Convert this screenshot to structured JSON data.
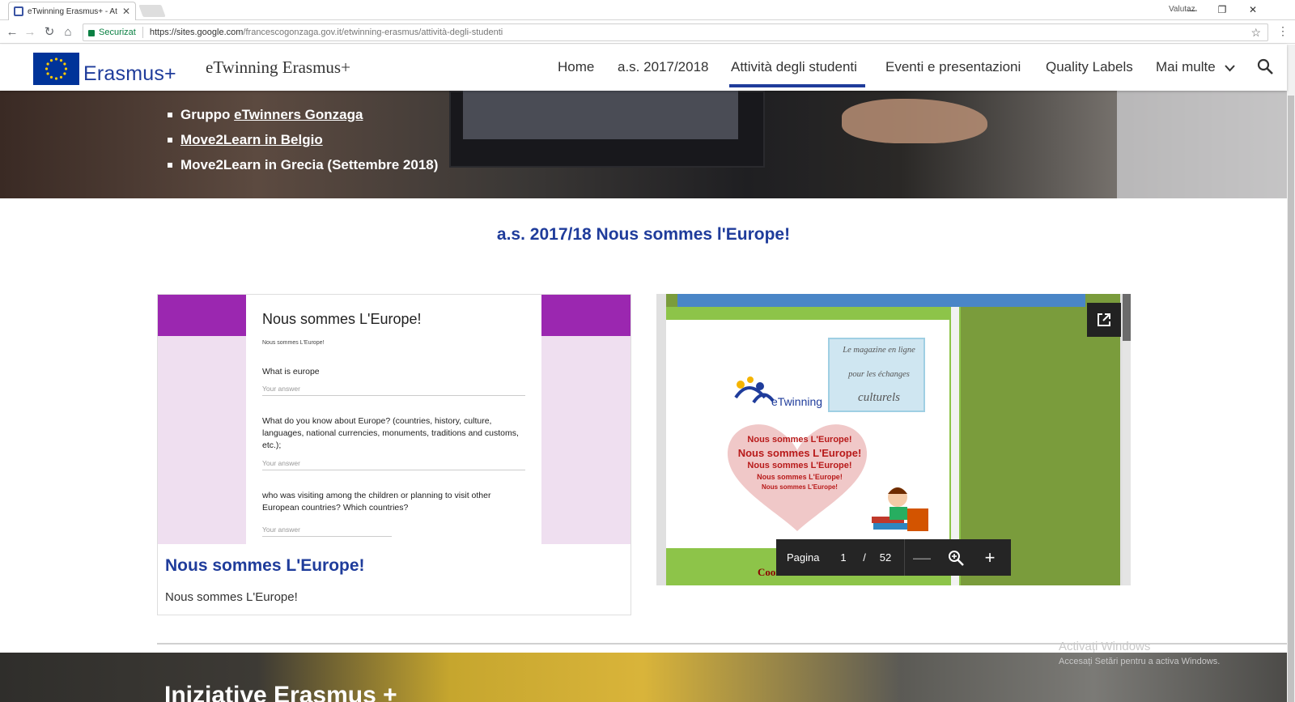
{
  "browser": {
    "tab_title": "eTwinning Erasmus+ - At",
    "tab_close": "✕",
    "profile_name": "Valutaz",
    "window_controls": [
      "—",
      "❐",
      "✕"
    ],
    "nav_icons": [
      "back-icon",
      "forward-icon",
      "reload-icon",
      "home-icon"
    ],
    "secure_label": "Securizat",
    "url_host": "https://sites.google.com",
    "url_path": "/francescogonzaga.gov.it/etwinning-erasmus/attività-degli-studenti",
    "star": "☆",
    "menu": "⋮"
  },
  "header": {
    "logo_text": "Erasmus+",
    "site_title": "eTwinning Erasmus+",
    "nav": [
      {
        "label": "Home"
      },
      {
        "label": "a.s. 2017/2018"
      },
      {
        "label": "Attività degli studenti",
        "active": true
      },
      {
        "label": "Eventi e presentazioni"
      },
      {
        "label": "Quality Labels"
      },
      {
        "label": "Mai multe"
      }
    ],
    "chevron": "⌄"
  },
  "hero": {
    "items": [
      {
        "prefix": "Gruppo ",
        "link": "eTwinners Gonzaga",
        "suffix": ""
      },
      {
        "prefix": "",
        "link": "Move2Learn in Belgio",
        "suffix": ""
      },
      {
        "prefix": "Move2Learn in Grecia (Settembre 2018)",
        "link": "",
        "suffix": ""
      }
    ]
  },
  "section": {
    "title": "a.s. 2017/18 Nous sommes l'Europe!"
  },
  "form_card": {
    "form_title": "Nous sommes L'Europe!",
    "form_subtitle": "Nous sommes L'Europe!",
    "questions": [
      {
        "text": "What is europe",
        "answer": "Your answer"
      },
      {
        "text": "What do you know about Europe? (countries, history, culture, languages, national currencies, monuments, traditions and customs, etc.);",
        "answer": "Your answer"
      },
      {
        "text": "who was visiting among the children or planning to visit other European countries? Which countries?",
        "answer": "Your answer"
      }
    ],
    "title": "Nous sommes L'Europe!",
    "description": "Nous sommes L'Europe!"
  },
  "pdf_card": {
    "magazine_lines": [
      "Le magazine en ligne",
      "pour les échanges",
      "culturels"
    ],
    "etwinning_text": "eTwinning",
    "heart_lines": [
      "Nous sommes L'Europe!",
      "Nous sommes L'Europe!",
      "Nous sommes L'Europe!",
      "Nous sommes L'Europe!",
      "Nous sommes L'Europe!"
    ],
    "coordinator": "Coordonator:",
    "toolbar": {
      "label": "Pagina",
      "page": "1",
      "slash": "/",
      "total": "52",
      "zoom_out": "—",
      "zoom_in": "+"
    }
  },
  "bottom": {
    "title": "Iniziative Erasmus +"
  },
  "watermark": {
    "line1": "Activați Windows",
    "line2": "Accesați Setări pentru a activa Windows."
  },
  "colors": {
    "brand_blue": "#1f3c9b",
    "form_purple": "#9b27b0",
    "pdf_green": "#8dc449",
    "secure_green": "#0b8043"
  }
}
